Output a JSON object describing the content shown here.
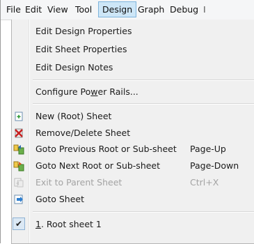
{
  "menubar": {
    "items": [
      "File",
      "Edit",
      "View",
      "Tool",
      "Design",
      "Graph",
      "Debug"
    ],
    "active": "Design"
  },
  "design_menu": {
    "edit_design_properties": "Edit Design Properties",
    "edit_sheet_properties": "Edit Sheet Properties",
    "edit_design_notes": "Edit Design Notes",
    "configure_power_rails": {
      "before": "Configure Po",
      "mnemonic": "w",
      "after": "er Rails..."
    },
    "new_root_sheet": "New (Root) Sheet",
    "remove_delete_sheet": "Remove/Delete Sheet",
    "goto_previous": {
      "label": "Goto Previous Root or Sub-sheet",
      "shortcut": "Page-Up"
    },
    "goto_next": {
      "label": "Goto Next Root or Sub-sheet",
      "shortcut": "Page-Down"
    },
    "exit_to_parent": {
      "label": "Exit to Parent Sheet",
      "shortcut": "Ctrl+X",
      "enabled": false
    },
    "goto_sheet": "Goto Sheet",
    "root_sheet_1": {
      "mnemonic": "1",
      "after": ". Root sheet 1",
      "checked": true
    }
  },
  "icons": {
    "new_sheet": "new-sheet-icon",
    "remove_sheet": "remove-sheet-icon",
    "goto_previous": "goto-previous-sheet-icon",
    "goto_next": "goto-next-sheet-icon",
    "exit_parent": "exit-parent-sheet-icon",
    "goto_sheet": "goto-sheet-icon",
    "check": "checkmark-icon"
  },
  "colors": {
    "active_menu_bg": "#cde6f7",
    "active_menu_border": "#7fb4dc",
    "menu_bg": "#f0f0f0",
    "disabled_text": "#a3a3a3"
  }
}
